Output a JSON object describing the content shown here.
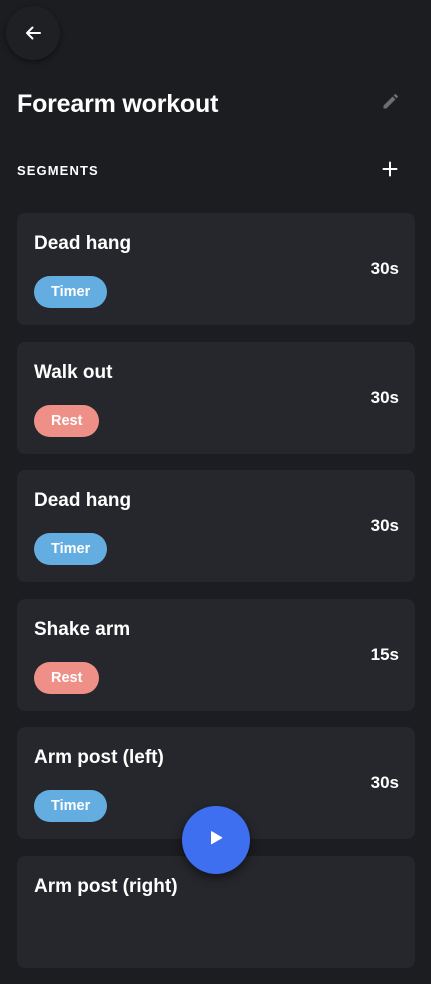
{
  "header": {
    "back_icon": "arrow-left-icon",
    "title": "Forearm workout",
    "edit_icon": "pencil-icon"
  },
  "segments_section": {
    "label": "SEGMENTS",
    "add_icon": "plus-icon"
  },
  "colors": {
    "background": "#1c1d21",
    "card": "#26272c",
    "timer_badge": "#64ade0",
    "rest_badge": "#ee9088",
    "play_button": "#3d6ff0"
  },
  "segments": [
    {
      "name": "Dead hang",
      "type": "Timer",
      "duration": "30s"
    },
    {
      "name": "Walk out",
      "type": "Rest",
      "duration": "30s"
    },
    {
      "name": "Dead hang",
      "type": "Timer",
      "duration": "30s"
    },
    {
      "name": "Shake arm",
      "type": "Rest",
      "duration": "15s"
    },
    {
      "name": "Arm post (left)",
      "type": "Timer",
      "duration": "30s"
    },
    {
      "name": "Arm post (right)",
      "type": "",
      "duration": ""
    }
  ],
  "fab": {
    "icon": "play-icon"
  }
}
